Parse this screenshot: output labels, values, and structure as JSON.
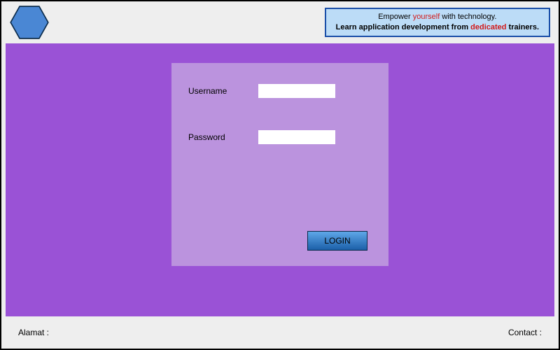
{
  "header": {
    "banner": {
      "line1_pre": "Empower ",
      "line1_highlight": "yourself",
      "line1_post": " with technology.",
      "line2_pre": "Learn application development from ",
      "line2_highlight": "dedicated",
      "line2_post": " trainers."
    }
  },
  "login": {
    "username_label": "Username",
    "password_label": "Password",
    "username_value": "",
    "password_value": "",
    "button_label": "LOGIN"
  },
  "footer": {
    "left": "Alamat :",
    "right": "Contact :"
  },
  "colors": {
    "accent_purple": "#9a52d6",
    "card_purple": "#bb93de",
    "banner_bg": "#bcdcf7",
    "banner_border": "#1a4ea8",
    "highlight_red": "#d21919"
  }
}
